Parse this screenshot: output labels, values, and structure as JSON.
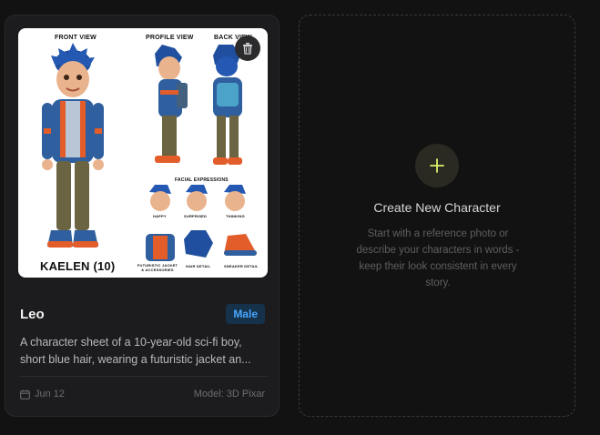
{
  "character_card": {
    "name": "Leo",
    "gender_badge": "Male",
    "description": "A character sheet of a 10-year-old sci-fi boy, short blue hair, wearing a futuristic jacket an...",
    "date": "Jun 12",
    "model": "Model: 3D Pixar",
    "thumbnail": {
      "front_view": "FRONT VIEW",
      "profile_view": "PROFILE VIEW",
      "back_view": "BACK VIEW",
      "facial_expressions": "FACIAL EXPRESSIONS",
      "happy": "HAPPY",
      "surprised": "SURPRISED",
      "thinking": "THINKING",
      "jacket_accessories": "FUTURISTIC JACKET & ACCESSORIES",
      "hair_detail": "HAIR DETAIL",
      "sneaker_detail": "SNEAKER DETAIL",
      "character_caption": "KAELEN (10)"
    }
  },
  "create_card": {
    "title": "Create New Character",
    "hint": "Start with a reference photo or describe your characters in words - keep their look consistent in every story."
  },
  "colors": {
    "background": "#121212",
    "card": "#1c1c1e",
    "badge_bg": "#16324a",
    "badge_text": "#48a7ff",
    "plus_accent": "#d8f26a"
  },
  "icons": {
    "trash": "trash-icon",
    "calendar": "calendar-icon",
    "plus": "plus-icon"
  }
}
